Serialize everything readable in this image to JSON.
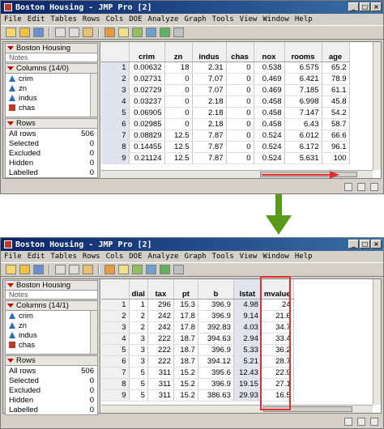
{
  "window_title": "Boston Housing - JMP Pro [2]",
  "menu": [
    "File",
    "Edit",
    "Tables",
    "Rows",
    "Cols",
    "DOE",
    "Analyze",
    "Graph",
    "Tools",
    "View",
    "Window",
    "Help"
  ],
  "panel": {
    "table_name": "Boston Housing",
    "columns_header_top": "Columns (14/0)",
    "columns_header_bottom": "Columns (14/1)",
    "columns": [
      {
        "name": "crim",
        "icon": "continuous-icon"
      },
      {
        "name": "zn",
        "icon": "continuous-icon"
      },
      {
        "name": "indus",
        "icon": "continuous-icon"
      },
      {
        "name": "chas",
        "icon": "nominal-icon"
      }
    ],
    "rows_header": "Rows",
    "rows": [
      {
        "label": "All rows",
        "value": "506"
      },
      {
        "label": "Selected",
        "value": "0"
      },
      {
        "label": "Excluded",
        "value": "0"
      },
      {
        "label": "Hidden",
        "value": "0"
      },
      {
        "label": "Labelled",
        "value": "0"
      }
    ]
  },
  "top_grid": {
    "headers": [
      "crim",
      "zn",
      "indus",
      "chas",
      "nox",
      "rooms",
      "age"
    ],
    "rows": [
      [
        "1",
        "0.00632",
        "18",
        "2.31",
        "0",
        "0.538",
        "6.575",
        "65.2"
      ],
      [
        "2",
        "0.02731",
        "0",
        "7.07",
        "0",
        "0.469",
        "6.421",
        "78.9"
      ],
      [
        "3",
        "0.02729",
        "0",
        "7.07",
        "0",
        "0.469",
        "7.185",
        "61.1"
      ],
      [
        "4",
        "0.03237",
        "0",
        "2.18",
        "0",
        "0.458",
        "6.998",
        "45.8"
      ],
      [
        "5",
        "0.06905",
        "0",
        "2.18",
        "0",
        "0.458",
        "7.147",
        "54.2"
      ],
      [
        "6",
        "0.02985",
        "0",
        "2.18",
        "0",
        "0.458",
        "6.43",
        "58.7"
      ],
      [
        "7",
        "0.08829",
        "12.5",
        "7.87",
        "0",
        "0.524",
        "6.012",
        "66.6"
      ],
      [
        "8",
        "0.14455",
        "12.5",
        "7.87",
        "0",
        "0.524",
        "6.172",
        "96.1"
      ],
      [
        "9",
        "0.21124",
        "12.5",
        "7.87",
        "0",
        "0.524",
        "5.631",
        "100"
      ]
    ]
  },
  "bottom_grid": {
    "headers": [
      "dial",
      "tax",
      "pt",
      "b",
      "lstat",
      "mvalue"
    ],
    "rows": [
      [
        "1",
        "1",
        "296",
        "15.3",
        "396.9",
        "4.98",
        "24"
      ],
      [
        "2",
        "2",
        "242",
        "17.8",
        "396.9",
        "9.14",
        "21.6"
      ],
      [
        "3",
        "2",
        "242",
        "17.8",
        "392.83",
        "4.03",
        "34.7"
      ],
      [
        "4",
        "3",
        "222",
        "18.7",
        "394.63",
        "2.94",
        "33.4"
      ],
      [
        "5",
        "3",
        "222",
        "18.7",
        "396.9",
        "5.33",
        "36.2"
      ],
      [
        "6",
        "3",
        "222",
        "18.7",
        "394.12",
        "5.21",
        "28.7"
      ],
      [
        "7",
        "5",
        "311",
        "15.2",
        "395.6",
        "12.43",
        "22.9"
      ],
      [
        "8",
        "5",
        "311",
        "15.2",
        "396.9",
        "19.15",
        "27.1"
      ],
      [
        "9",
        "5",
        "311",
        "15.2",
        "386.63",
        "29.93",
        "16.5"
      ]
    ]
  },
  "colors": {
    "titlebar": "#0a246a",
    "highlight": "#e03030",
    "arrow_green": "#5a9a1a"
  }
}
